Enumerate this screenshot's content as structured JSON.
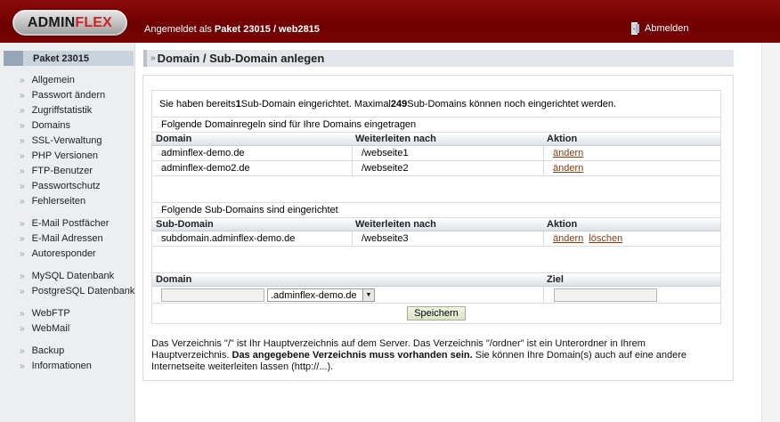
{
  "header": {
    "logo_left": "ADMIN",
    "logo_right": "FLEX",
    "login_prefix": "Angemeldet als ",
    "login_account": "Paket 23015 / web2815",
    "logout_label": "Abmelden"
  },
  "sidebar": {
    "package": "Paket 23015",
    "items": [
      {
        "label": "Allgemein"
      },
      {
        "label": "Passwort ändern"
      },
      {
        "label": "Zugriffstatistik"
      },
      {
        "label": "Domains"
      },
      {
        "label": "SSL-Verwaltung"
      },
      {
        "label": "PHP Versionen"
      },
      {
        "label": "FTP-Benutzer"
      },
      {
        "label": "Passwortschutz"
      },
      {
        "label": "Fehlerseiten"
      },
      {
        "label": "E-Mail Postfächer"
      },
      {
        "label": "E-Mail Adressen"
      },
      {
        "label": "Autoresponder"
      },
      {
        "label": "MySQL Datenbank"
      },
      {
        "label": "PostgreSQL Datenbank"
      },
      {
        "label": "WebFTP"
      },
      {
        "label": "WebMail"
      },
      {
        "label": "Backup"
      },
      {
        "label": "Informationen"
      }
    ]
  },
  "page": {
    "title": "Domain / Sub-Domain anlegen",
    "info_prefix": "Sie haben bereits ",
    "info_count": "1",
    "info_middle": " Sub-Domain eingerichtet. Maximal ",
    "info_max": "249",
    "info_suffix": " Sub-Domains können noch eingerichtet werden."
  },
  "domain_rules": {
    "label": "Folgende Domainregeln sind für Ihre Domains eingetragen",
    "headers": [
      "Domain",
      "Weiterleiten nach",
      "Aktion"
    ],
    "rows": [
      {
        "domain": "adminflex-demo.de",
        "target": "/webseite1",
        "action": "ändern"
      },
      {
        "domain": "adminflex-demo2.de",
        "target": "/webseite2",
        "action": "ändern"
      }
    ]
  },
  "subdomains": {
    "label": "Folgende Sub-Domains sind eingerichtet",
    "headers": [
      "Sub-Domain",
      "Weiterleiten nach",
      "Aktion"
    ],
    "rows": [
      {
        "domain": "subdomain.adminflex-demo.de",
        "target": "/webseite3",
        "action_edit": "ändern",
        "action_delete": "löschen"
      }
    ]
  },
  "form": {
    "headers": [
      "Domain",
      "Ziel"
    ],
    "domain_value": "",
    "select_value": ".adminflex-demo.de",
    "target_value": "",
    "submit_label": "Speichern"
  },
  "note": {
    "text1": "Das Verzeichnis \"/\" ist Ihr Hauptverzeichnis auf dem Server. Das Verzeichnis \"/ordner\" ist ein Unterordner in Ihrem Hauptverzeichnis. ",
    "bold": "Das angegebene Verzeichnis muss vorhanden sein.",
    "text2": " Sie können Ihre Domain(s) auch auf eine andere Internetseite weiterleiten lassen (http://...)."
  },
  "colors": {
    "header_red": "#7a0303",
    "link": "#8a3b0f"
  }
}
